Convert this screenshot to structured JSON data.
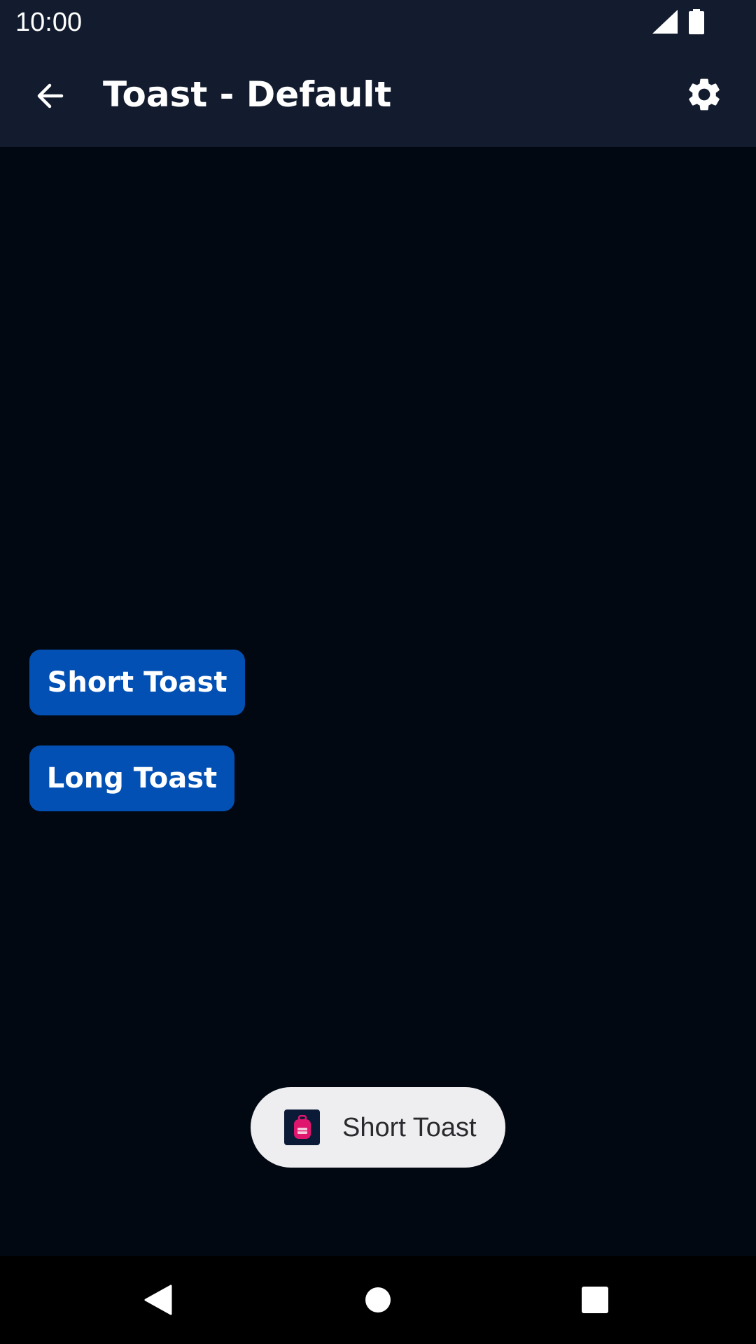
{
  "status_bar": {
    "time": "10:00",
    "signal_icon": "cellular-signal-icon",
    "battery_icon": "battery-icon"
  },
  "app_bar": {
    "title": "Toast - Default",
    "back_icon": "arrow-back-icon",
    "settings_icon": "gear-icon"
  },
  "buttons": {
    "short_toast": "Short Toast",
    "long_toast": "Long Toast"
  },
  "toast": {
    "message": "Short Toast",
    "app_icon": "backpack-app-icon"
  },
  "nav_bar": {
    "back_icon": "nav-back-triangle-icon",
    "home_icon": "nav-home-circle-icon",
    "recents_icon": "nav-recents-square-icon"
  },
  "colors": {
    "background": "#020812",
    "app_bar": "#131C2E",
    "button": "#0350B4",
    "toast_background": "#EEEEF0",
    "toast_icon_accent": "#E0156E"
  }
}
